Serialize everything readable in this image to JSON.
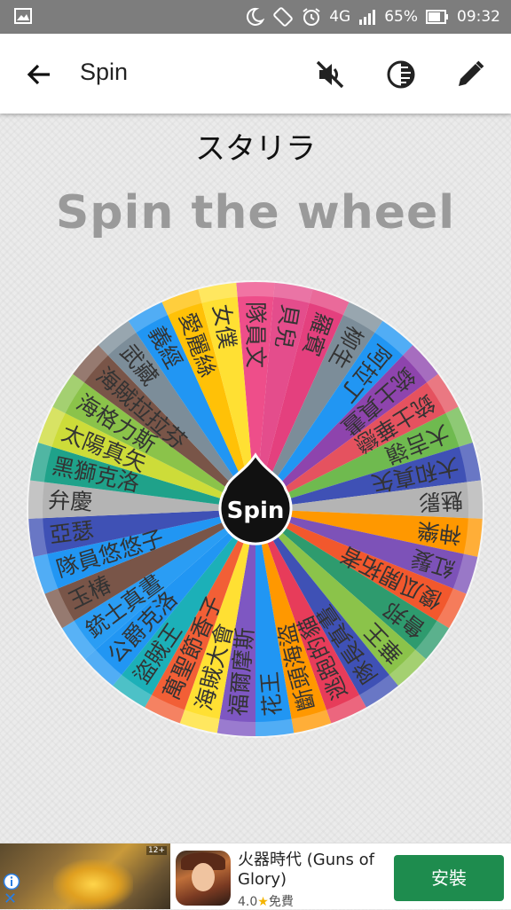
{
  "status_bar": {
    "network": "4G",
    "battery": "65%",
    "time": "09:32",
    "icons": [
      "image-icon",
      "moon-icon",
      "rotate-icon",
      "alarm-icon",
      "signal-icon",
      "battery-icon"
    ]
  },
  "toolbar": {
    "title": "Spin",
    "icons": [
      "back-arrow-icon",
      "mute-icon",
      "contrast-icon",
      "edit-icon"
    ]
  },
  "wheel_name": "スタリラ",
  "headline": "Spin the wheel",
  "spin_button_label": "Spin",
  "wheel": {
    "slices": [
      {
        "label": "隊員文",
        "color": "#ee4e8a"
      },
      {
        "label": "貝兒",
        "color": "#e44d8c"
      },
      {
        "label": "羅賓",
        "color": "#e4407e"
      },
      {
        "label": "柳生",
        "color": "#7c8d99"
      },
      {
        "label": "阿拉丁",
        "color": "#2196f3"
      },
      {
        "label": "銃士真晝",
        "color": "#8e44ad"
      },
      {
        "label": "銃士華戀",
        "color": "#e5525f"
      },
      {
        "label": "大吉嶺",
        "color": "#6fba4f"
      },
      {
        "label": "大和真矢",
        "color": "#3f51b5"
      },
      {
        "label": "魅影",
        "color": "#b4b4b4"
      },
      {
        "label": "神樂",
        "color": "#ff9800"
      },
      {
        "label": "紅髮",
        "color": "#7d52b8"
      },
      {
        "label": "傻瓜開拓者",
        "color": "#f2582d"
      },
      {
        "label": "鲁邦",
        "color": "#2e9b6e"
      },
      {
        "label": "華王",
        "color": "#8bc34a"
      },
      {
        "label": "隊長真晝",
        "color": "#3f51b5"
      },
      {
        "label": "逃跑的貓",
        "color": "#e73c5a"
      },
      {
        "label": "斷頭海盜",
        "color": "#ff9800"
      },
      {
        "label": "花王",
        "color": "#2196f3"
      },
      {
        "label": "福爾摩斯",
        "color": "#7e57c2"
      },
      {
        "label": "海賊大會",
        "color": "#ffe033"
      },
      {
        "label": "萬聖節香子",
        "color": "#f25f36"
      },
      {
        "label": "盜賊王",
        "color": "#1cb0b8"
      },
      {
        "label": "公爵克洛",
        "color": "#2196f3"
      },
      {
        "label": "銃士真晝",
        "color": "#2a9df4"
      },
      {
        "label": "玉椿",
        "color": "#795548"
      },
      {
        "label": "隊員悠悠子",
        "color": "#2196f3"
      },
      {
        "label": "亞瑟",
        "color": "#3f51b5"
      },
      {
        "label": "弁慶",
        "color": "#b4b4b4"
      },
      {
        "label": "黑獅克洛",
        "color": "#1fa28a"
      },
      {
        "label": "太陽真矢",
        "color": "#cddc39"
      },
      {
        "label": "海格力斯",
        "color": "#8bc34a"
      },
      {
        "label": "海賊拉拉芬",
        "color": "#795548"
      },
      {
        "label": "武藏",
        "color": "#7c8d99"
      },
      {
        "label": "義經",
        "color": "#2196f3"
      },
      {
        "label": "愛麗絲",
        "color": "#ffc107"
      },
      {
        "label": "女僕",
        "color": "#ffe033"
      }
    ]
  },
  "ad": {
    "age_rating": "12+",
    "app_name": "火器時代 (Guns of Glory)",
    "rating": "4.0",
    "price": "免費",
    "install_label": "安裝",
    "close_label": "✕"
  }
}
